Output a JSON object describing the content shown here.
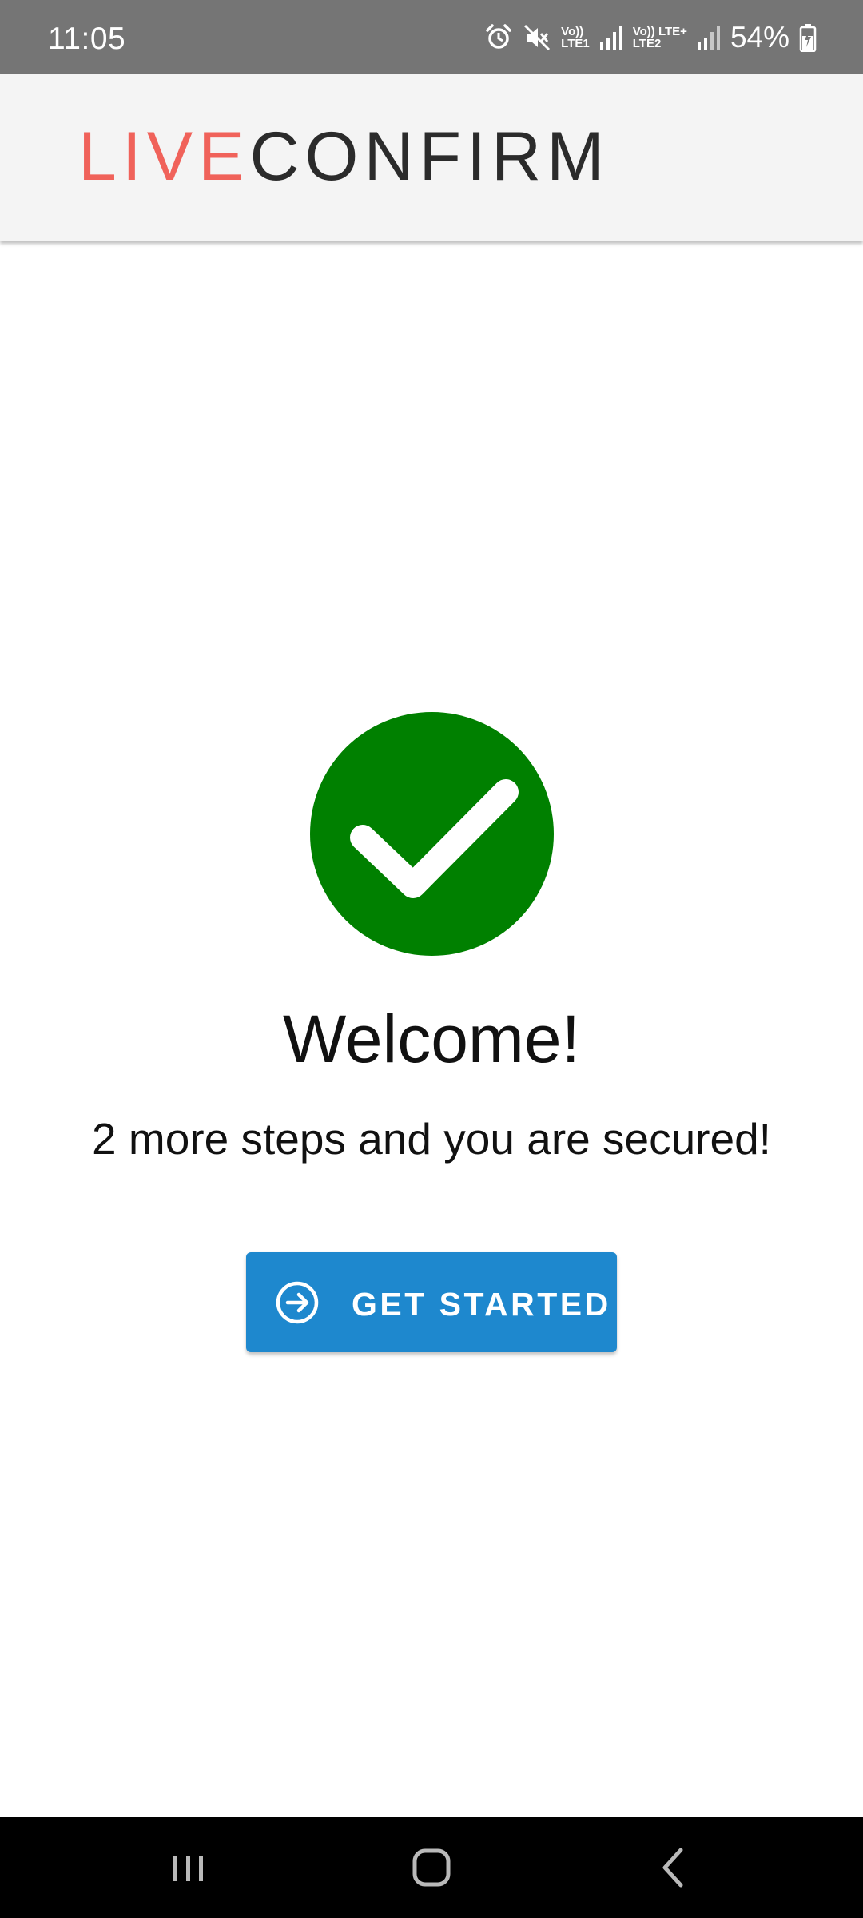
{
  "status_bar": {
    "time": "11:05",
    "net1_top": "Vo))",
    "net1_bottom": "LTE1",
    "net2_top": "Vo)) LTE+",
    "net2_bottom": "LTE2",
    "battery": "54%",
    "icons": [
      "alarm-icon",
      "mute-icon",
      "signal-icon",
      "signal-icon",
      "battery-charging-icon"
    ]
  },
  "app_bar": {
    "brand_part1": "LIVE",
    "brand_part2": "CONFIRM"
  },
  "main": {
    "status_icon": "check-circle-icon",
    "title": "Welcome!",
    "subtitle": "2 more steps and you are secured!",
    "cta": {
      "label": "GET STARTED",
      "icon": "arrow-right-circle-icon"
    }
  },
  "nav_bar": {
    "buttons": [
      "recents-icon",
      "home-icon",
      "back-icon"
    ]
  },
  "colors": {
    "status_bar_bg": "#757575",
    "brand_accent": "#f0625a",
    "brand_dark": "#2b2b2b",
    "success_green": "#008000",
    "primary_button": "#1e88ce"
  }
}
